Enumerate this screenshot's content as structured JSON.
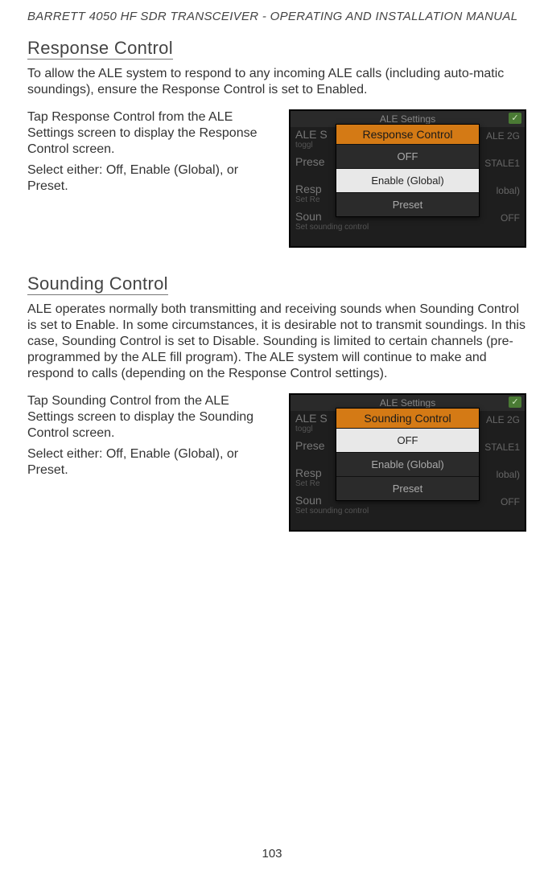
{
  "header": "BARRETT 4050 HF SDR TRANSCEIVER - OPERATING AND INSTALLATION MANUAL",
  "page_number": "103",
  "section1": {
    "title": "Response Control",
    "intro": "To allow the ALE system to respond to any incoming ALE calls (including auto-matic soundings), ensure the Response Control is set to Enabled.",
    "instr_tap_prefix": "Tap ",
    "instr_tap_item": "Response Control",
    "instr_tap_suffix": " from the ALE Settings screen to display the Response Control screen.",
    "instr_select": "Select either: Off, Enable (Global), or Preset.",
    "screenshot": {
      "top_title": "ALE Settings",
      "bg": {
        "r1": "ALE S",
        "r1r": "ALE 2G",
        "r2": "Prese",
        "r2r": "STALE1",
        "r3": "Resp",
        "r3r": "lobal)",
        "r4": "Soun",
        "r4r": "OFF",
        "r1sub": "toggl",
        "r3sub": "Set Re",
        "r4sub": "Set sounding control"
      },
      "popup": {
        "title": "Response Control",
        "opt1": "OFF",
        "opt2": "Enable (Global)",
        "opt3": "Preset",
        "selected_index": 1
      }
    }
  },
  "section2": {
    "title": "Sounding Control",
    "intro": "ALE operates normally both transmitting and receiving sounds when Sounding Control is set to Enable. In some circumstances, it is desirable not to transmit soundings. In this case, Sounding Control is set to Disable. Sounding is limited to certain channels (pre-programmed by the ALE fill program). The ALE system will continue to make and respond to calls (depending on the Response Control settings).",
    "instr_tap_prefix": "Tap ",
    "instr_tap_item": "Sounding Control",
    "instr_tap_suffix": " from the ALE Settings screen to display the Sounding Control screen.",
    "instr_select": "Select either: Off, Enable (Global), or Preset.",
    "screenshot": {
      "top_title": "ALE Settings",
      "bg": {
        "r1": "ALE S",
        "r1r": "ALE 2G",
        "r2": "Prese",
        "r2r": "STALE1",
        "r3": "Resp",
        "r3r": "lobal)",
        "r4": "Soun",
        "r4r": "OFF",
        "r1sub": "toggl",
        "r3sub": "Set Re",
        "r4sub": "Set sounding control"
      },
      "popup": {
        "title": "Sounding Control",
        "opt1": "OFF",
        "opt2": "Enable (Global)",
        "opt3": "Preset",
        "selected_index": 0
      }
    }
  }
}
